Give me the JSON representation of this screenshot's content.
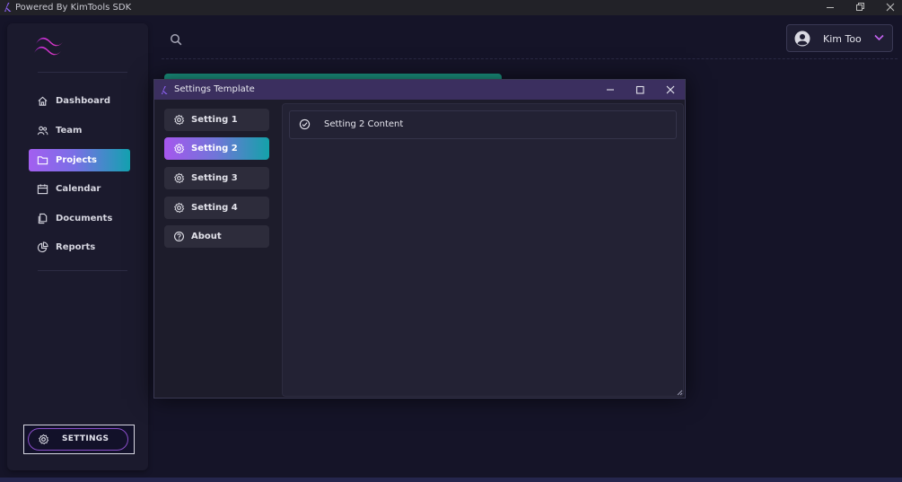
{
  "window": {
    "title": "Powered By KimTools SDK"
  },
  "sidebar": {
    "items": [
      {
        "label": "Dashboard",
        "icon": "home-icon"
      },
      {
        "label": "Team",
        "icon": "users-icon"
      },
      {
        "label": "Projects",
        "icon": "folder-icon",
        "active": true
      },
      {
        "label": "Calendar",
        "icon": "calendar-icon"
      },
      {
        "label": "Documents",
        "icon": "documents-icon"
      },
      {
        "label": "Reports",
        "icon": "pie-chart-icon"
      }
    ],
    "settings_label": "SETTINGS"
  },
  "header": {
    "user_name": "Kim Too"
  },
  "dialog": {
    "title": "Settings Template",
    "items": [
      {
        "label": "Setting 1",
        "icon": "gear-icon"
      },
      {
        "label": "Setting 2",
        "icon": "gear-icon",
        "active": true
      },
      {
        "label": "Setting 3",
        "icon": "gear-icon"
      },
      {
        "label": "Setting 4",
        "icon": "gear-icon"
      },
      {
        "label": "About",
        "icon": "info-icon"
      }
    ],
    "content_text": "Setting 2 Content"
  },
  "colors": {
    "background": "#151428",
    "sidebar": "#1b1a2d",
    "accent_purple": "#a35ff0",
    "accent_teal": "#13a2b0",
    "dialog_title_bar": "#3b2f5f"
  }
}
